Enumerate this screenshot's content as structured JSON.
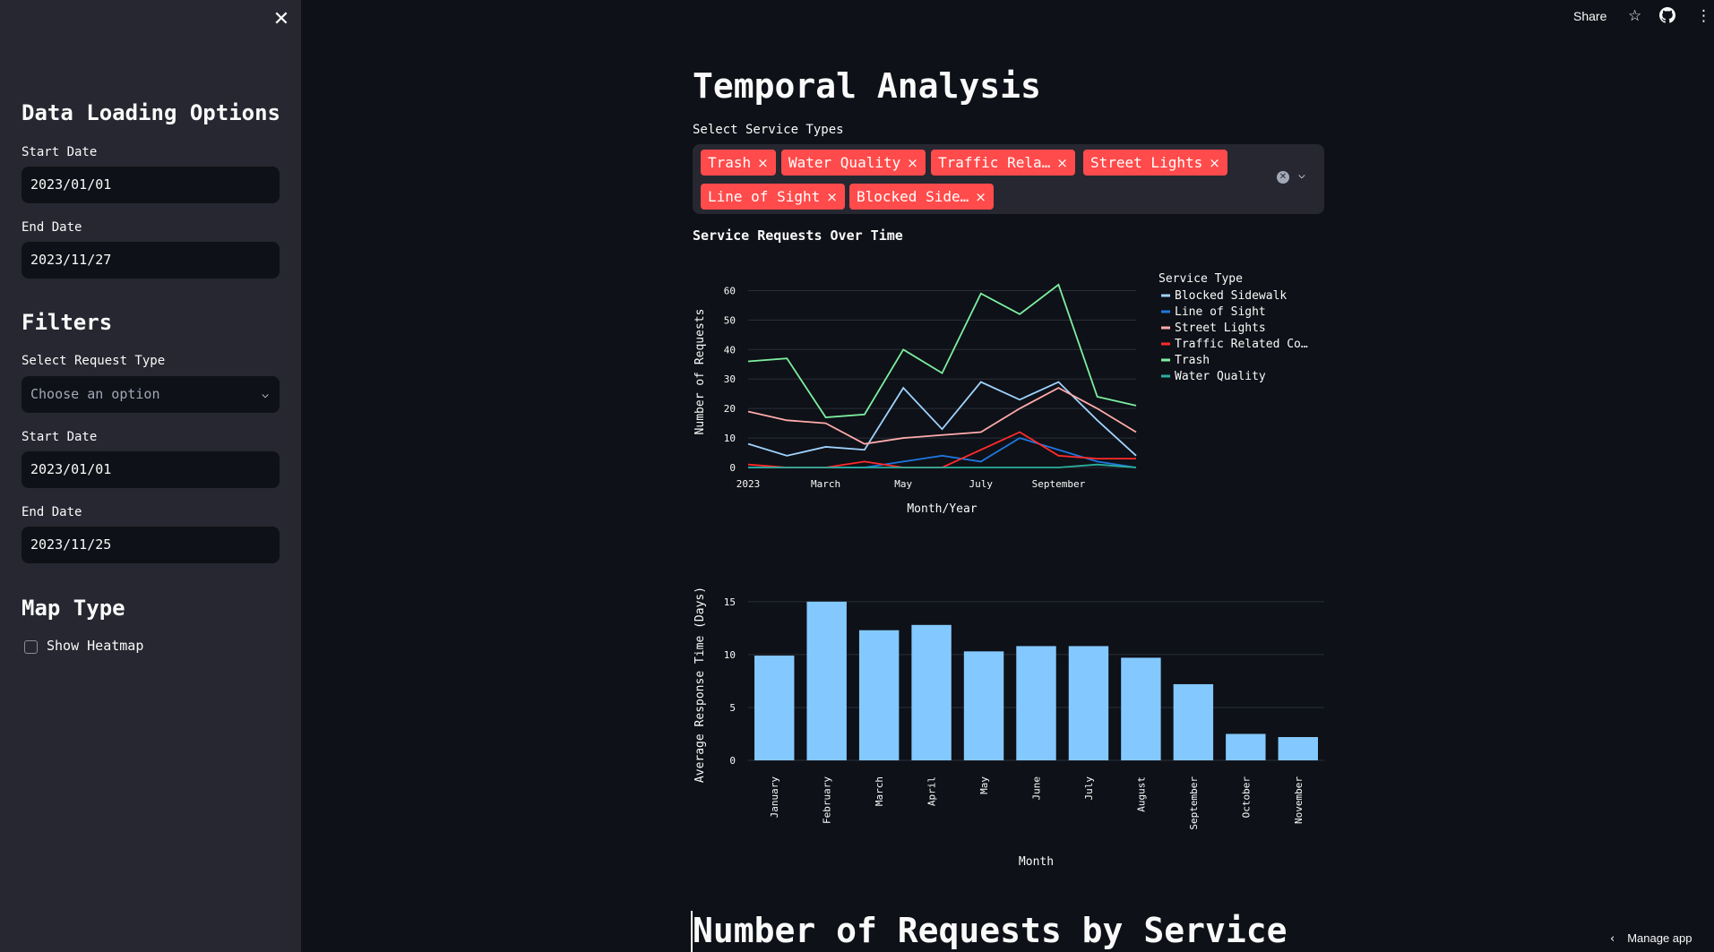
{
  "sidebar": {
    "close_icon": "close-icon",
    "data_loading_heading": "Data Loading Options",
    "start_date_label": "Start Date",
    "start_date_value": "2023/01/01",
    "end_date_label": "End Date",
    "end_date_value": "2023/11/27",
    "filters_heading": "Filters",
    "request_type_label": "Select Request Type",
    "request_type_placeholder": "Choose an option",
    "filter_start_label": "Start Date",
    "filter_start_value": "2023/01/01",
    "filter_end_label": "End Date",
    "filter_end_value": "2023/11/25",
    "map_type_heading": "Map Type",
    "heatmap_label": "Show Heatmap"
  },
  "topbar": {
    "share_label": "Share"
  },
  "main": {
    "title": "Temporal Analysis",
    "service_types_label": "Select Service Types",
    "selected_tags": [
      "Trash",
      "Water Quality",
      "Traffic Rela…",
      "Street Lights",
      "Line of Sight",
      "Blocked Side…"
    ],
    "section_heading": "Number of Requests by Service"
  },
  "manage_app_label": "Manage app",
  "colors": {
    "accent": "#ff4b4b",
    "sidebar_bg": "#262730",
    "app_bg": "#0e1117"
  },
  "chart_data": [
    {
      "type": "line",
      "title": "Service Requests Over Time",
      "xlabel": "Month/Year",
      "ylabel": "Number of Requests",
      "x": [
        "2023-01",
        "2023-02",
        "2023-03",
        "2023-04",
        "2023-05",
        "2023-06",
        "2023-07",
        "2023-08",
        "2023-09",
        "2023-10",
        "2023-11"
      ],
      "x_tick_labels": [
        "2023",
        "March",
        "May",
        "July",
        "September"
      ],
      "y_ticks": [
        0,
        10,
        20,
        30,
        40,
        50,
        60
      ],
      "ylim": [
        0,
        65
      ],
      "legend_title": "Service Type",
      "legend_position": "right",
      "series": [
        {
          "name": "Blocked Sidewalk",
          "color": "#9fd3ff",
          "values": [
            8,
            4,
            7,
            6,
            27,
            13,
            29,
            23,
            29,
            16,
            4
          ]
        },
        {
          "name": "Line of Sight",
          "color": "#1f77e0",
          "values": [
            0,
            0,
            0,
            0,
            2,
            4,
            2,
            10,
            6,
            2,
            0
          ]
        },
        {
          "name": "Street Lights",
          "color": "#ffabab",
          "values": [
            19,
            16,
            15,
            8,
            10,
            11,
            12,
            20,
            27,
            20,
            12
          ]
        },
        {
          "name": "Traffic Related Co…",
          "color": "#ff2b2b",
          "values": [
            1,
            0,
            0,
            2,
            0,
            0,
            6,
            12,
            4,
            3,
            3
          ]
        },
        {
          "name": "Trash",
          "color": "#7defa1",
          "values": [
            36,
            37,
            17,
            18,
            40,
            32,
            59,
            52,
            62,
            24,
            21
          ]
        },
        {
          "name": "Water Quality",
          "color": "#29b09d",
          "values": [
            0,
            0,
            0,
            0,
            0,
            0,
            0,
            0,
            0,
            1,
            0
          ]
        }
      ]
    },
    {
      "type": "bar",
      "xlabel": "Month",
      "ylabel": "Average Response Time (Days)",
      "categories": [
        "January",
        "February",
        "March",
        "April",
        "May",
        "June",
        "July",
        "August",
        "September",
        "October",
        "November"
      ],
      "values": [
        9.9,
        15.0,
        12.3,
        12.8,
        10.3,
        10.8,
        10.8,
        9.7,
        7.2,
        2.5,
        2.2
      ],
      "y_ticks": [
        0,
        5,
        10,
        15
      ],
      "ylim": [
        0,
        16
      ],
      "bar_color": "#83c9ff"
    }
  ]
}
